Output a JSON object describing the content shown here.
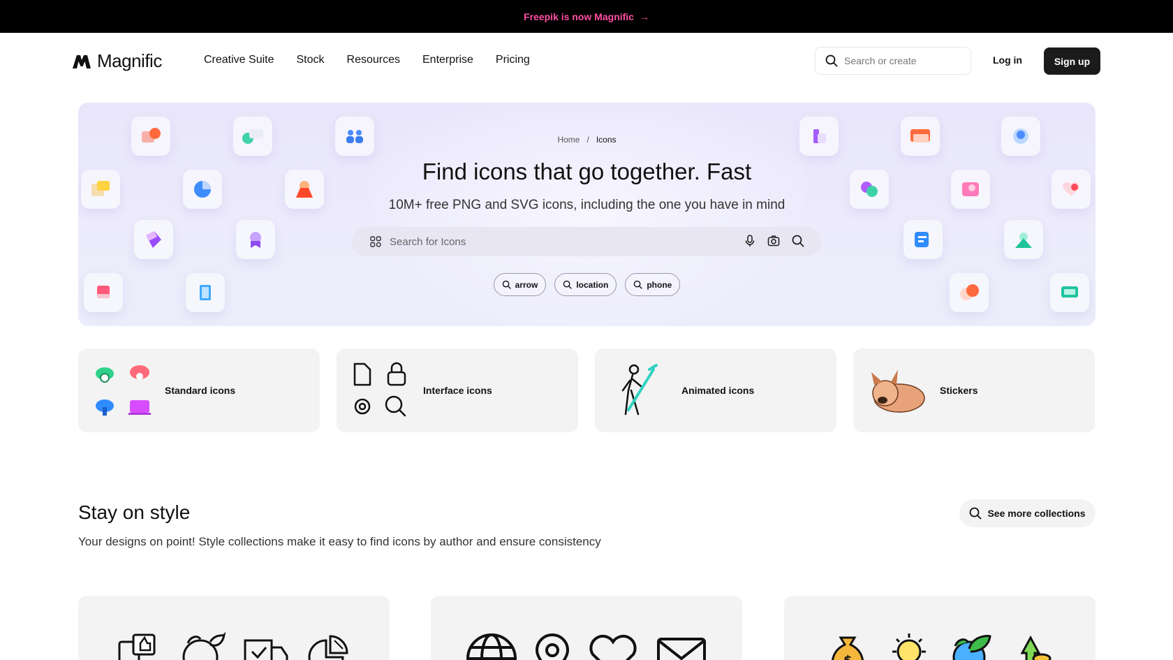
{
  "announcement": {
    "text": "Freepik is now Magnific",
    "arrow": "→"
  },
  "header": {
    "logo_text": "Magnific",
    "nav": [
      "Creative Suite",
      "Stock",
      "Resources",
      "Enterprise",
      "Pricing"
    ],
    "search_placeholder": "Search or create",
    "login_label": "Log in",
    "signup_label": "Sign up"
  },
  "hero": {
    "breadcrumb": {
      "home": "Home",
      "separator": "/",
      "current": "Icons"
    },
    "title": "Find icons that go together. Fast",
    "subtitle": "10M+ free PNG and SVG icons, including the one you have in mind",
    "search_placeholder": "Search for Icons",
    "chips": [
      "arrow",
      "location",
      "phone"
    ]
  },
  "categories": [
    {
      "label": "Standard icons"
    },
    {
      "label": "Interface icons"
    },
    {
      "label": "Animated icons"
    },
    {
      "label": "Stickers"
    }
  ],
  "style_section": {
    "title": "Stay on style",
    "description": "Your designs on point! Style collections make it easy to find icons by author and ensure consistency",
    "more_label": "See more collections"
  },
  "colors": {
    "brand_pink": "#ff4fa3",
    "dark": "#1b1b1b",
    "hero_bg": "#e9e6fb"
  }
}
